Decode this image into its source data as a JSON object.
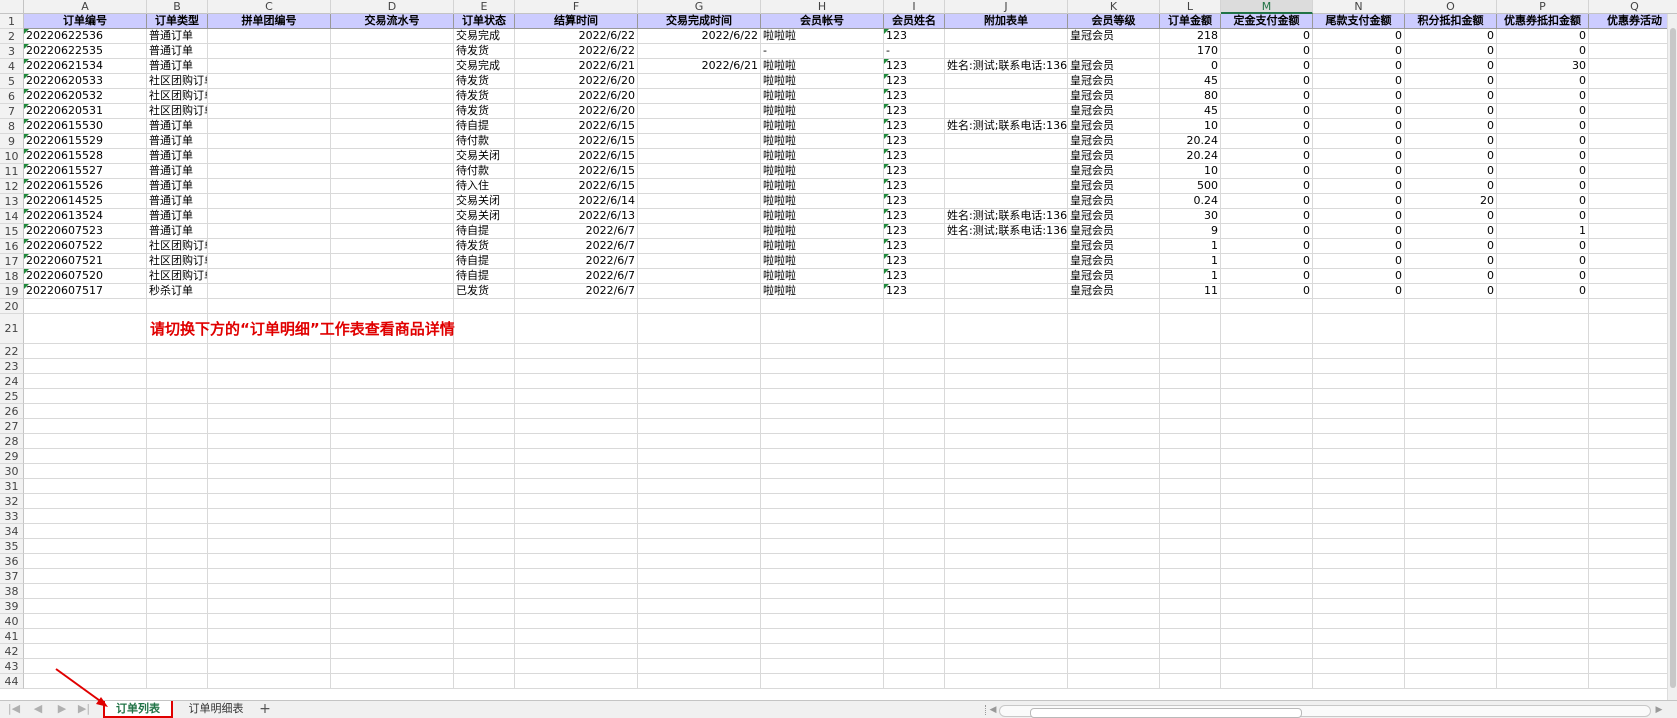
{
  "spreadsheet": {
    "column_letters": [
      "A",
      "B",
      "C",
      "D",
      "E",
      "F",
      "G",
      "H",
      "I",
      "J",
      "K",
      "L",
      "M",
      "N",
      "O",
      "P",
      "Q"
    ],
    "selected_column": "M",
    "row_numbers": [
      "1",
      "2",
      "3",
      "4",
      "5",
      "6",
      "7",
      "8",
      "9",
      "10",
      "11",
      "12",
      "13",
      "14",
      "15",
      "16",
      "17",
      "18",
      "19",
      "20",
      "21",
      "22",
      "23",
      "24",
      "25",
      "26",
      "27",
      "28",
      "29",
      "30",
      "31",
      "32",
      "33",
      "34",
      "35",
      "36",
      "37",
      "38",
      "39",
      "40",
      "41",
      "42",
      "43",
      "44"
    ],
    "headers": [
      "订单编号",
      "订单类型",
      "拼单团编号",
      "交易流水号",
      "订单状态",
      "结算时间",
      "交易完成时间",
      "会员帐号",
      "会员姓名",
      "附加表单",
      "会员等级",
      "订单金额",
      "定金支付金额",
      "尾款支付金额",
      "积分抵扣金额",
      "优惠券抵扣金额",
      "优惠券活动"
    ],
    "rows": [
      [
        "20220622536",
        "普通订单",
        "",
        "",
        "交易完成",
        "2022/6/22",
        "2022/6/22",
        "啦啦啦",
        "123",
        "",
        "皇冠会员",
        "218",
        "0",
        "0",
        "0",
        "0",
        ""
      ],
      [
        "20220622535",
        "普通订单",
        "",
        "",
        "待发货",
        "2022/6/22",
        "",
        "-",
        "-",
        "",
        "",
        "170",
        "0",
        "0",
        "0",
        "0",
        ""
      ],
      [
        "20220621534",
        "普通订单",
        "",
        "",
        "交易完成",
        "2022/6/21",
        "2022/6/21",
        "啦啦啦",
        "123",
        "姓名:测试;联系电话:136",
        "皇冠会员",
        "0",
        "0",
        "0",
        "0",
        "30",
        ""
      ],
      [
        "20220620533",
        "社区团购订单",
        "",
        "",
        "待发货",
        "2022/6/20",
        "",
        "啦啦啦",
        "123",
        "",
        "皇冠会员",
        "45",
        "0",
        "0",
        "0",
        "0",
        ""
      ],
      [
        "20220620532",
        "社区团购订单",
        "",
        "",
        "待发货",
        "2022/6/20",
        "",
        "啦啦啦",
        "123",
        "",
        "皇冠会员",
        "80",
        "0",
        "0",
        "0",
        "0",
        ""
      ],
      [
        "20220620531",
        "社区团购订单",
        "",
        "",
        "待发货",
        "2022/6/20",
        "",
        "啦啦啦",
        "123",
        "",
        "皇冠会员",
        "45",
        "0",
        "0",
        "0",
        "0",
        ""
      ],
      [
        "20220615530",
        "普通订单",
        "",
        "",
        "待自提",
        "2022/6/15",
        "",
        "啦啦啦",
        "123",
        "姓名:测试;联系电话:136",
        "皇冠会员",
        "10",
        "0",
        "0",
        "0",
        "0",
        ""
      ],
      [
        "20220615529",
        "普通订单",
        "",
        "",
        "待付款",
        "2022/6/15",
        "",
        "啦啦啦",
        "123",
        "",
        "皇冠会员",
        "20.24",
        "0",
        "0",
        "0",
        "0",
        ""
      ],
      [
        "20220615528",
        "普通订单",
        "",
        "",
        "交易关闭",
        "2022/6/15",
        "",
        "啦啦啦",
        "123",
        "",
        "皇冠会员",
        "20.24",
        "0",
        "0",
        "0",
        "0",
        ""
      ],
      [
        "20220615527",
        "普通订单",
        "",
        "",
        "待付款",
        "2022/6/15",
        "",
        "啦啦啦",
        "123",
        "",
        "皇冠会员",
        "10",
        "0",
        "0",
        "0",
        "0",
        ""
      ],
      [
        "20220615526",
        "普通订单",
        "",
        "",
        "待入住",
        "2022/6/15",
        "",
        "啦啦啦",
        "123",
        "",
        "皇冠会员",
        "500",
        "0",
        "0",
        "0",
        "0",
        ""
      ],
      [
        "20220614525",
        "普通订单",
        "",
        "",
        "交易关闭",
        "2022/6/14",
        "",
        "啦啦啦",
        "123",
        "",
        "皇冠会员",
        "0.24",
        "0",
        "0",
        "20",
        "0",
        ""
      ],
      [
        "20220613524",
        "普通订单",
        "",
        "",
        "交易关闭",
        "2022/6/13",
        "",
        "啦啦啦",
        "123",
        "姓名:测试;联系电话:136",
        "皇冠会员",
        "30",
        "0",
        "0",
        "0",
        "0",
        ""
      ],
      [
        "20220607523",
        "普通订单",
        "",
        "",
        "待自提",
        "2022/6/7",
        "",
        "啦啦啦",
        "123",
        "姓名:测试;联系电话:136",
        "皇冠会员",
        "9",
        "0",
        "0",
        "0",
        "1",
        ""
      ],
      [
        "20220607522",
        "社区团购订单",
        "",
        "",
        "待发货",
        "2022/6/7",
        "",
        "啦啦啦",
        "123",
        "",
        "皇冠会员",
        "1",
        "0",
        "0",
        "0",
        "0",
        ""
      ],
      [
        "20220607521",
        "社区团购订单",
        "",
        "",
        "待自提",
        "2022/6/7",
        "",
        "啦啦啦",
        "123",
        "",
        "皇冠会员",
        "1",
        "0",
        "0",
        "0",
        "0",
        ""
      ],
      [
        "20220607520",
        "社区团购订单",
        "",
        "",
        "待自提",
        "2022/6/7",
        "",
        "啦啦啦",
        "123",
        "",
        "皇冠会员",
        "1",
        "0",
        "0",
        "0",
        "0",
        ""
      ],
      [
        "20220607517",
        "秒杀订单",
        "",
        "",
        "已发货",
        "2022/6/7",
        "",
        "啦啦啦",
        "123",
        "",
        "皇冠会员",
        "11",
        "0",
        "0",
        "0",
        "0",
        ""
      ]
    ],
    "note": "请切换下方的“订单明细”工作表查看商品详情"
  },
  "tabs": {
    "sheets": [
      {
        "label": "订单列表",
        "active": true
      },
      {
        "label": "订单明细表",
        "active": false
      }
    ],
    "add_label": "+",
    "nav_first": "|◀",
    "nav_prev": "◀",
    "nav_next": "▶",
    "nav_last": "▶|"
  },
  "colors": {
    "header_fill": "#ccccff",
    "note_text": "#e00000",
    "active_tab_text": "#217346",
    "highlight_border": "#e00000"
  }
}
